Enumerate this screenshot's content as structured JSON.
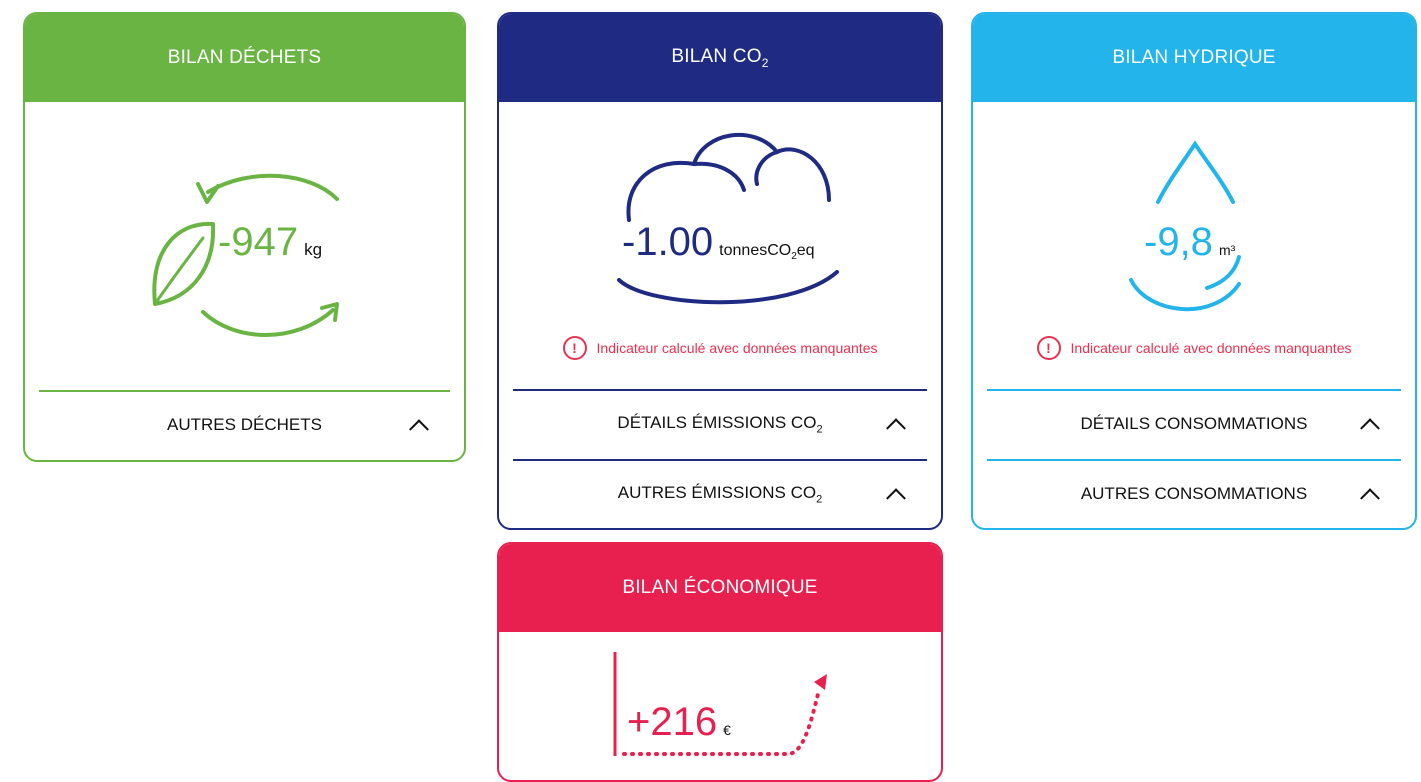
{
  "colors": {
    "waste": "#6ab444",
    "co2": "#1f2b83",
    "water": "#22b4ea",
    "eco": "#e8204f",
    "warning": "#e8314f"
  },
  "waste": {
    "title": "BILAN DÉCHETS",
    "value": "-947",
    "unit": "kg",
    "row1": "AUTRES DÉCHETS"
  },
  "co2": {
    "title": "BILAN CO",
    "title_sub": "2",
    "value": "-1.00",
    "unit_a": "tonnesCO",
    "unit_sub": "2",
    "unit_b": "eq",
    "warning": "Indicateur calculé avec données manquantes",
    "row1_a": "DÉTAILS ÉMISSIONS CO",
    "row1_sub": "2",
    "row2_a": "AUTRES ÉMISSIONS CO",
    "row2_sub": "2"
  },
  "water": {
    "title": "BILAN HYDRIQUE",
    "value": "-9,8",
    "unit": "m³",
    "warning": "Indicateur calculé avec données manquantes",
    "row1": "DÉTAILS CONSOMMATIONS",
    "row2": "AUTRES CONSOMMATIONS"
  },
  "eco": {
    "title": "BILAN ÉCONOMIQUE",
    "value": "+216",
    "unit": "€"
  },
  "icons": {
    "recycle": "recycle-arrows-icon",
    "leaf": "leaf-icon",
    "cloud": "cloud-icon",
    "drop": "water-drop-icon",
    "chart": "trend-chart-icon",
    "warning": "warning-icon",
    "chevron": "chevron-up-icon"
  }
}
